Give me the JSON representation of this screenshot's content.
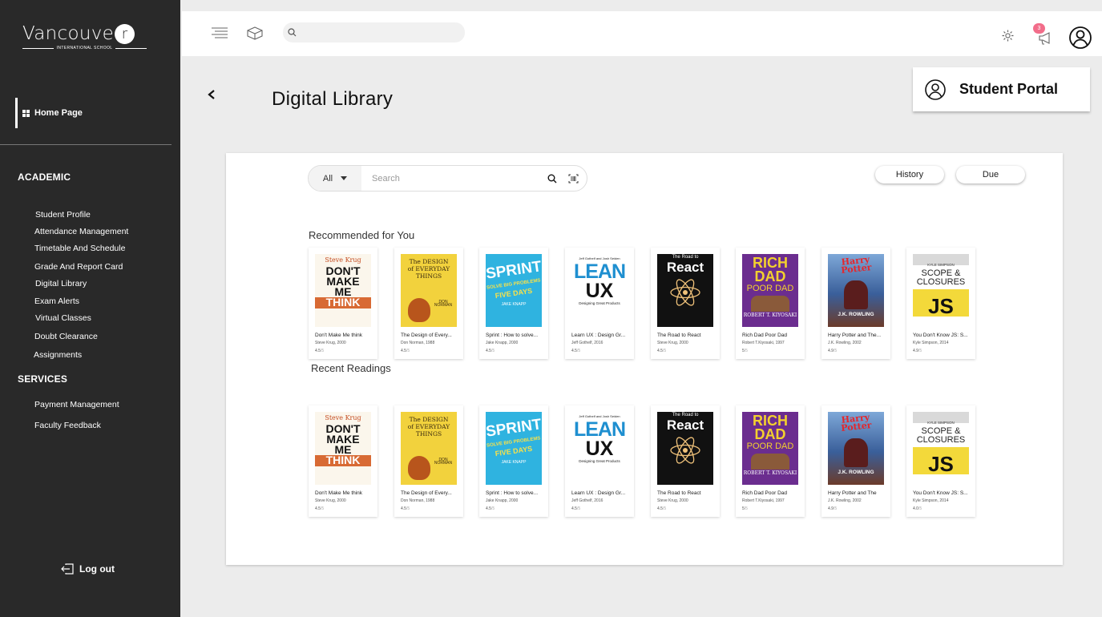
{
  "brand": {
    "name": "Vancouve",
    "name_circle": "r",
    "subtitle": "INTERNATIONAL SCHOOL"
  },
  "sidebar": {
    "home": "Home Page",
    "sections": [
      {
        "label": "ACADEMIC"
      },
      {
        "label": "SERVICES"
      }
    ],
    "academic": [
      "Student Profile",
      "Attendance Management",
      "Timetable And Schedule",
      "Grade And Report Card",
      "Digital Library",
      "Exam Alerts",
      "Virtual Classes",
      "Doubt Clearance",
      "Assignments"
    ],
    "services": [
      "Payment Management",
      "Faculty Feedback"
    ],
    "logout": "Log out"
  },
  "topbar": {
    "notification_count": "3"
  },
  "page": {
    "title": "Digital Library",
    "portal": "Student Portal"
  },
  "library": {
    "filter": "All",
    "search_placeholder": "Search",
    "history": "History",
    "due": "Due",
    "recommended_title": "Recommended for You",
    "recent_title": "Recent Readings",
    "recommended": [
      {
        "title": "Don't Make Me think",
        "author": "Steve Krug, 2000",
        "rating": "4.5",
        "out_of": "/5",
        "cover": "krug"
      },
      {
        "title": "The Design of Every...",
        "author": "Don Norman, 1988",
        "rating": "4.5",
        "out_of": "/5",
        "cover": "norman"
      },
      {
        "title": "Sprint : How to solve...",
        "author": "Jake Knapp, 2000",
        "rating": "4.5",
        "out_of": "/5",
        "cover": "sprint"
      },
      {
        "title": "Learn UX : Design Gr...",
        "author": "Jeff Gothelf, 2016",
        "rating": "4.5",
        "out_of": "/5",
        "cover": "leanux"
      },
      {
        "title": "The Road to React",
        "author": "Steve Krug, 2000",
        "rating": "4.5",
        "out_of": "/5",
        "cover": "react"
      },
      {
        "title": "Rich Dad Poor Dad",
        "author": "Robert T.Kiyosaki, 1997",
        "rating": "5",
        "out_of": "/5",
        "cover": "richdad"
      },
      {
        "title": "Harry Potter and The...",
        "author": "J.K. Rowling, 2002",
        "rating": "4.9",
        "out_of": "/5",
        "cover": "potter"
      },
      {
        "title": "You Don't Know JS: S...",
        "author": "Kyle Simpson, 2014",
        "rating": "4.9",
        "out_of": "/5",
        "cover": "js"
      }
    ],
    "recent": [
      {
        "title": "Don't Make Me think",
        "author": "Steve Krug, 2000",
        "rating": "4.5",
        "out_of": "/5",
        "cover": "krug"
      },
      {
        "title": "The Design of Every...",
        "author": "Don Norman, 1988",
        "rating": "4.5",
        "out_of": "/5",
        "cover": "norman"
      },
      {
        "title": "Sprint : How to solve...",
        "author": "Jake Knapp, 2000",
        "rating": "4.5",
        "out_of": "/5",
        "cover": "sprint"
      },
      {
        "title": "Learn UX : Design Gr...",
        "author": "Jeff Gothelf, 2016",
        "rating": "4.5",
        "out_of": "/5",
        "cover": "leanux"
      },
      {
        "title": "The Road to React",
        "author": "Steve Krug, 2000",
        "rating": "4.5",
        "out_of": "/5",
        "cover": "react"
      },
      {
        "title": "Rich Dad Poor Dad",
        "author": "Robert T.Kiyosaki, 1997",
        "rating": "5",
        "out_of": "/5",
        "cover": "richdad"
      },
      {
        "title": "Harry Potter and The",
        "author": "J.K. Rowling, 2002",
        "rating": "4.9",
        "out_of": "/5",
        "cover": "potter"
      },
      {
        "title": "You Don't Know JS: S...",
        "author": "Kyle Simpson, 2014",
        "rating": "4.0",
        "out_of": "/5",
        "cover": "js"
      }
    ]
  },
  "covers": {
    "krug": {
      "top": "Steve Krug",
      "l1": "DON'T",
      "l2": "MAKE",
      "l3": "ME",
      "l4": "THINK"
    },
    "norman": {
      "l1": "The DESIGN",
      "l2": "of EVERYDAY",
      "l3": "THINGS",
      "l4": "DON NORMAN"
    },
    "sprint": {
      "l1": "SPRINT",
      "l2": "SOLVE BIG PROBLEMS",
      "l3": "FIVE DAYS",
      "l4": "JAKE KNAPP"
    },
    "leanux": {
      "top": "Jeff Gothelf and Josh Seiden",
      "l1": "LEAN",
      "l2": "UX",
      "l3": "Designing Great Products"
    },
    "react": {
      "l1": "The Road to",
      "l2": "React"
    },
    "richdad": {
      "l1": "RICH",
      "l2": "DAD",
      "l3": "POOR DAD",
      "l4": "ROBERT T. KIYOSAKI"
    },
    "potter": {
      "l1": "Harry Potter",
      "l2": "J.K. ROWLING"
    },
    "js": {
      "top": "KYLE SIMPSON",
      "l1": "SCOPE &",
      "l2": "CLOSURES",
      "l3": "JS"
    }
  }
}
